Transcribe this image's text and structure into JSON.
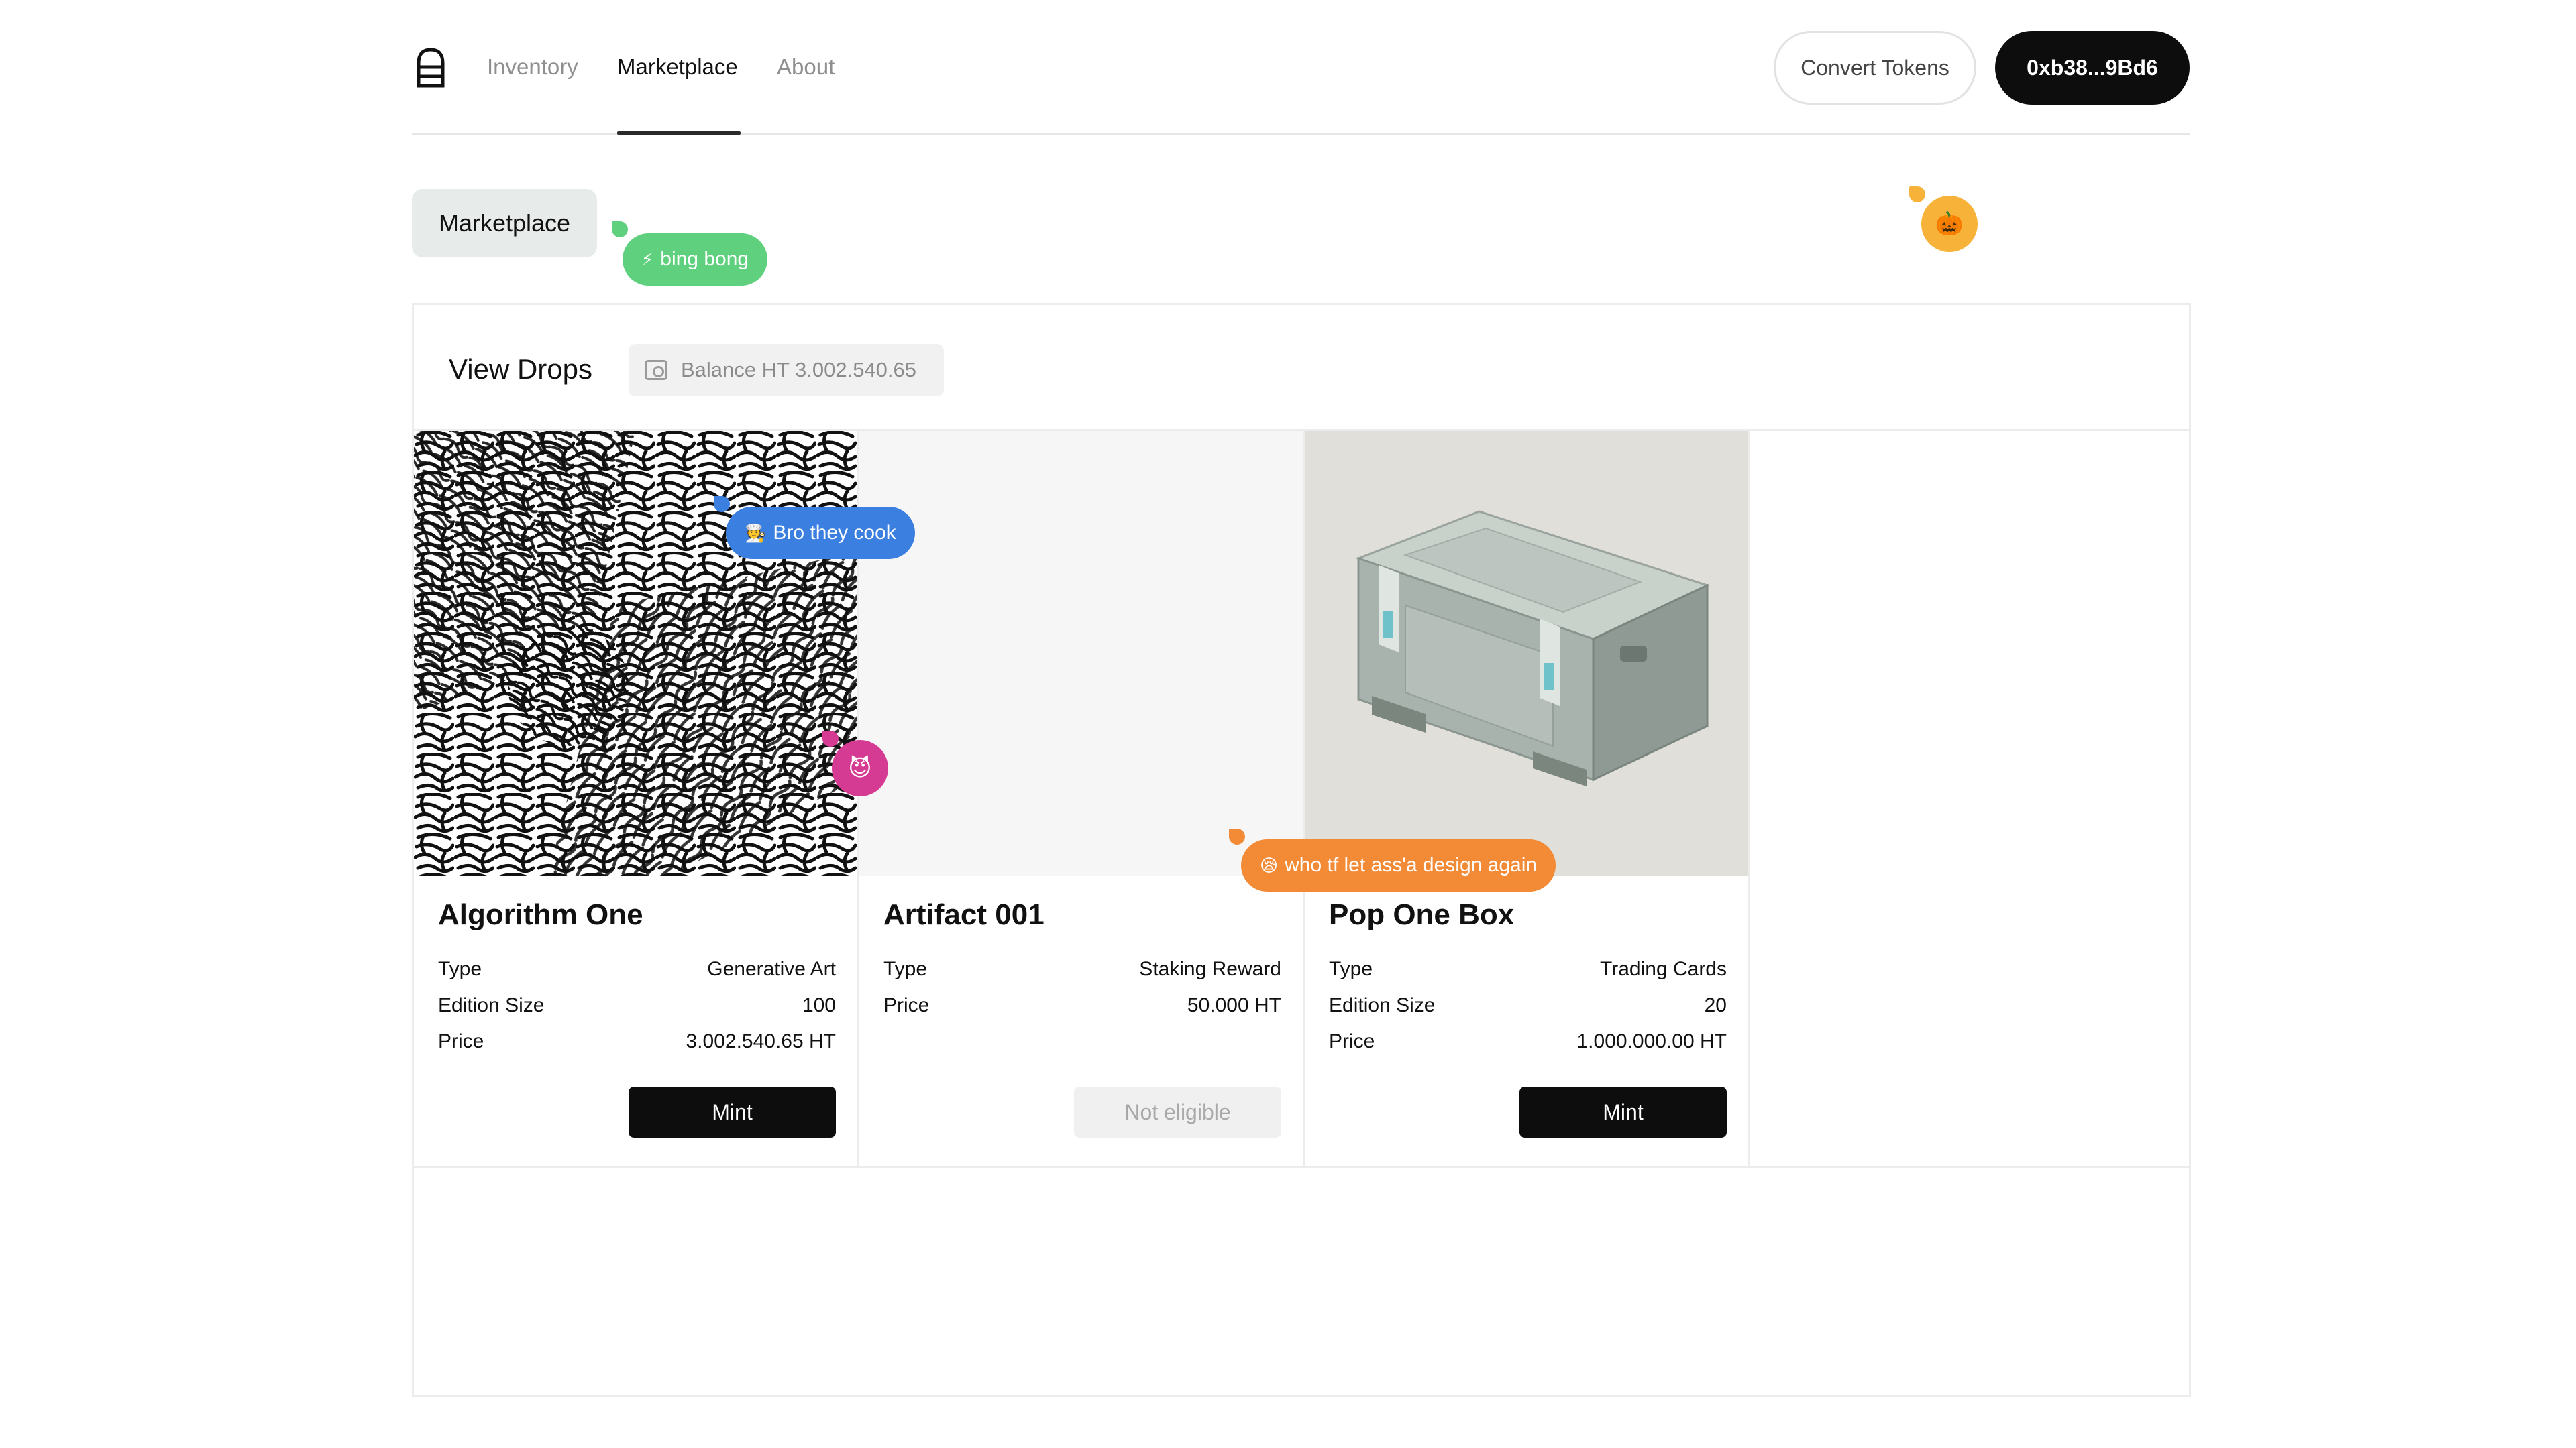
{
  "nav": {
    "items": [
      {
        "label": "Inventory",
        "active": false
      },
      {
        "label": "Marketplace",
        "active": true
      },
      {
        "label": "About",
        "active": false
      }
    ],
    "convert_label": "Convert Tokens",
    "wallet_label": "0xb38...9Bd6"
  },
  "page": {
    "tag": "Marketplace"
  },
  "panel": {
    "title": "View Drops",
    "balance": "Balance HT 3.002.540.65"
  },
  "cards": [
    {
      "title": "Algorithm One",
      "image": "generative-maze-art",
      "specs": [
        {
          "key": "Type",
          "value": "Generative Art"
        },
        {
          "key": "Edition Size",
          "value": "100"
        },
        {
          "key": "Price",
          "value": "3.002.540.65 HT"
        }
      ],
      "button": "Mint",
      "eligible": true
    },
    {
      "title": "Artifact 001",
      "image": "blank",
      "specs": [
        {
          "key": "Type",
          "value": "Staking Reward"
        },
        {
          "key": "Price",
          "value": "50.000 HT"
        }
      ],
      "button": "Not eligible",
      "eligible": false
    },
    {
      "title": "Pop One Box",
      "image": "storage-case-render",
      "specs": [
        {
          "key": "Type",
          "value": "Trading Cards"
        },
        {
          "key": "Edition Size",
          "value": "20"
        },
        {
          "key": "Price",
          "value": "1.000.000.00 HT"
        }
      ],
      "button": "Mint",
      "eligible": true
    }
  ],
  "cursors": [
    {
      "text": "bing bong",
      "emoji": "⚡",
      "color": "#5fd07d"
    },
    {
      "text": "",
      "emoji": "🎃",
      "color": "#f7b23a"
    },
    {
      "text": "Bro they cook",
      "emoji": "🧑‍🍳",
      "color": "#3b7fe0"
    },
    {
      "text": "",
      "emoji": "😈",
      "color": "#d63b93"
    },
    {
      "text": "who tf let ass'a design again",
      "emoji": "😪",
      "color": "#f28a36"
    }
  ],
  "colors": {
    "accent_dark": "#0d0d0d",
    "border": "#ececec",
    "tag_bg": "#e7ebea"
  }
}
